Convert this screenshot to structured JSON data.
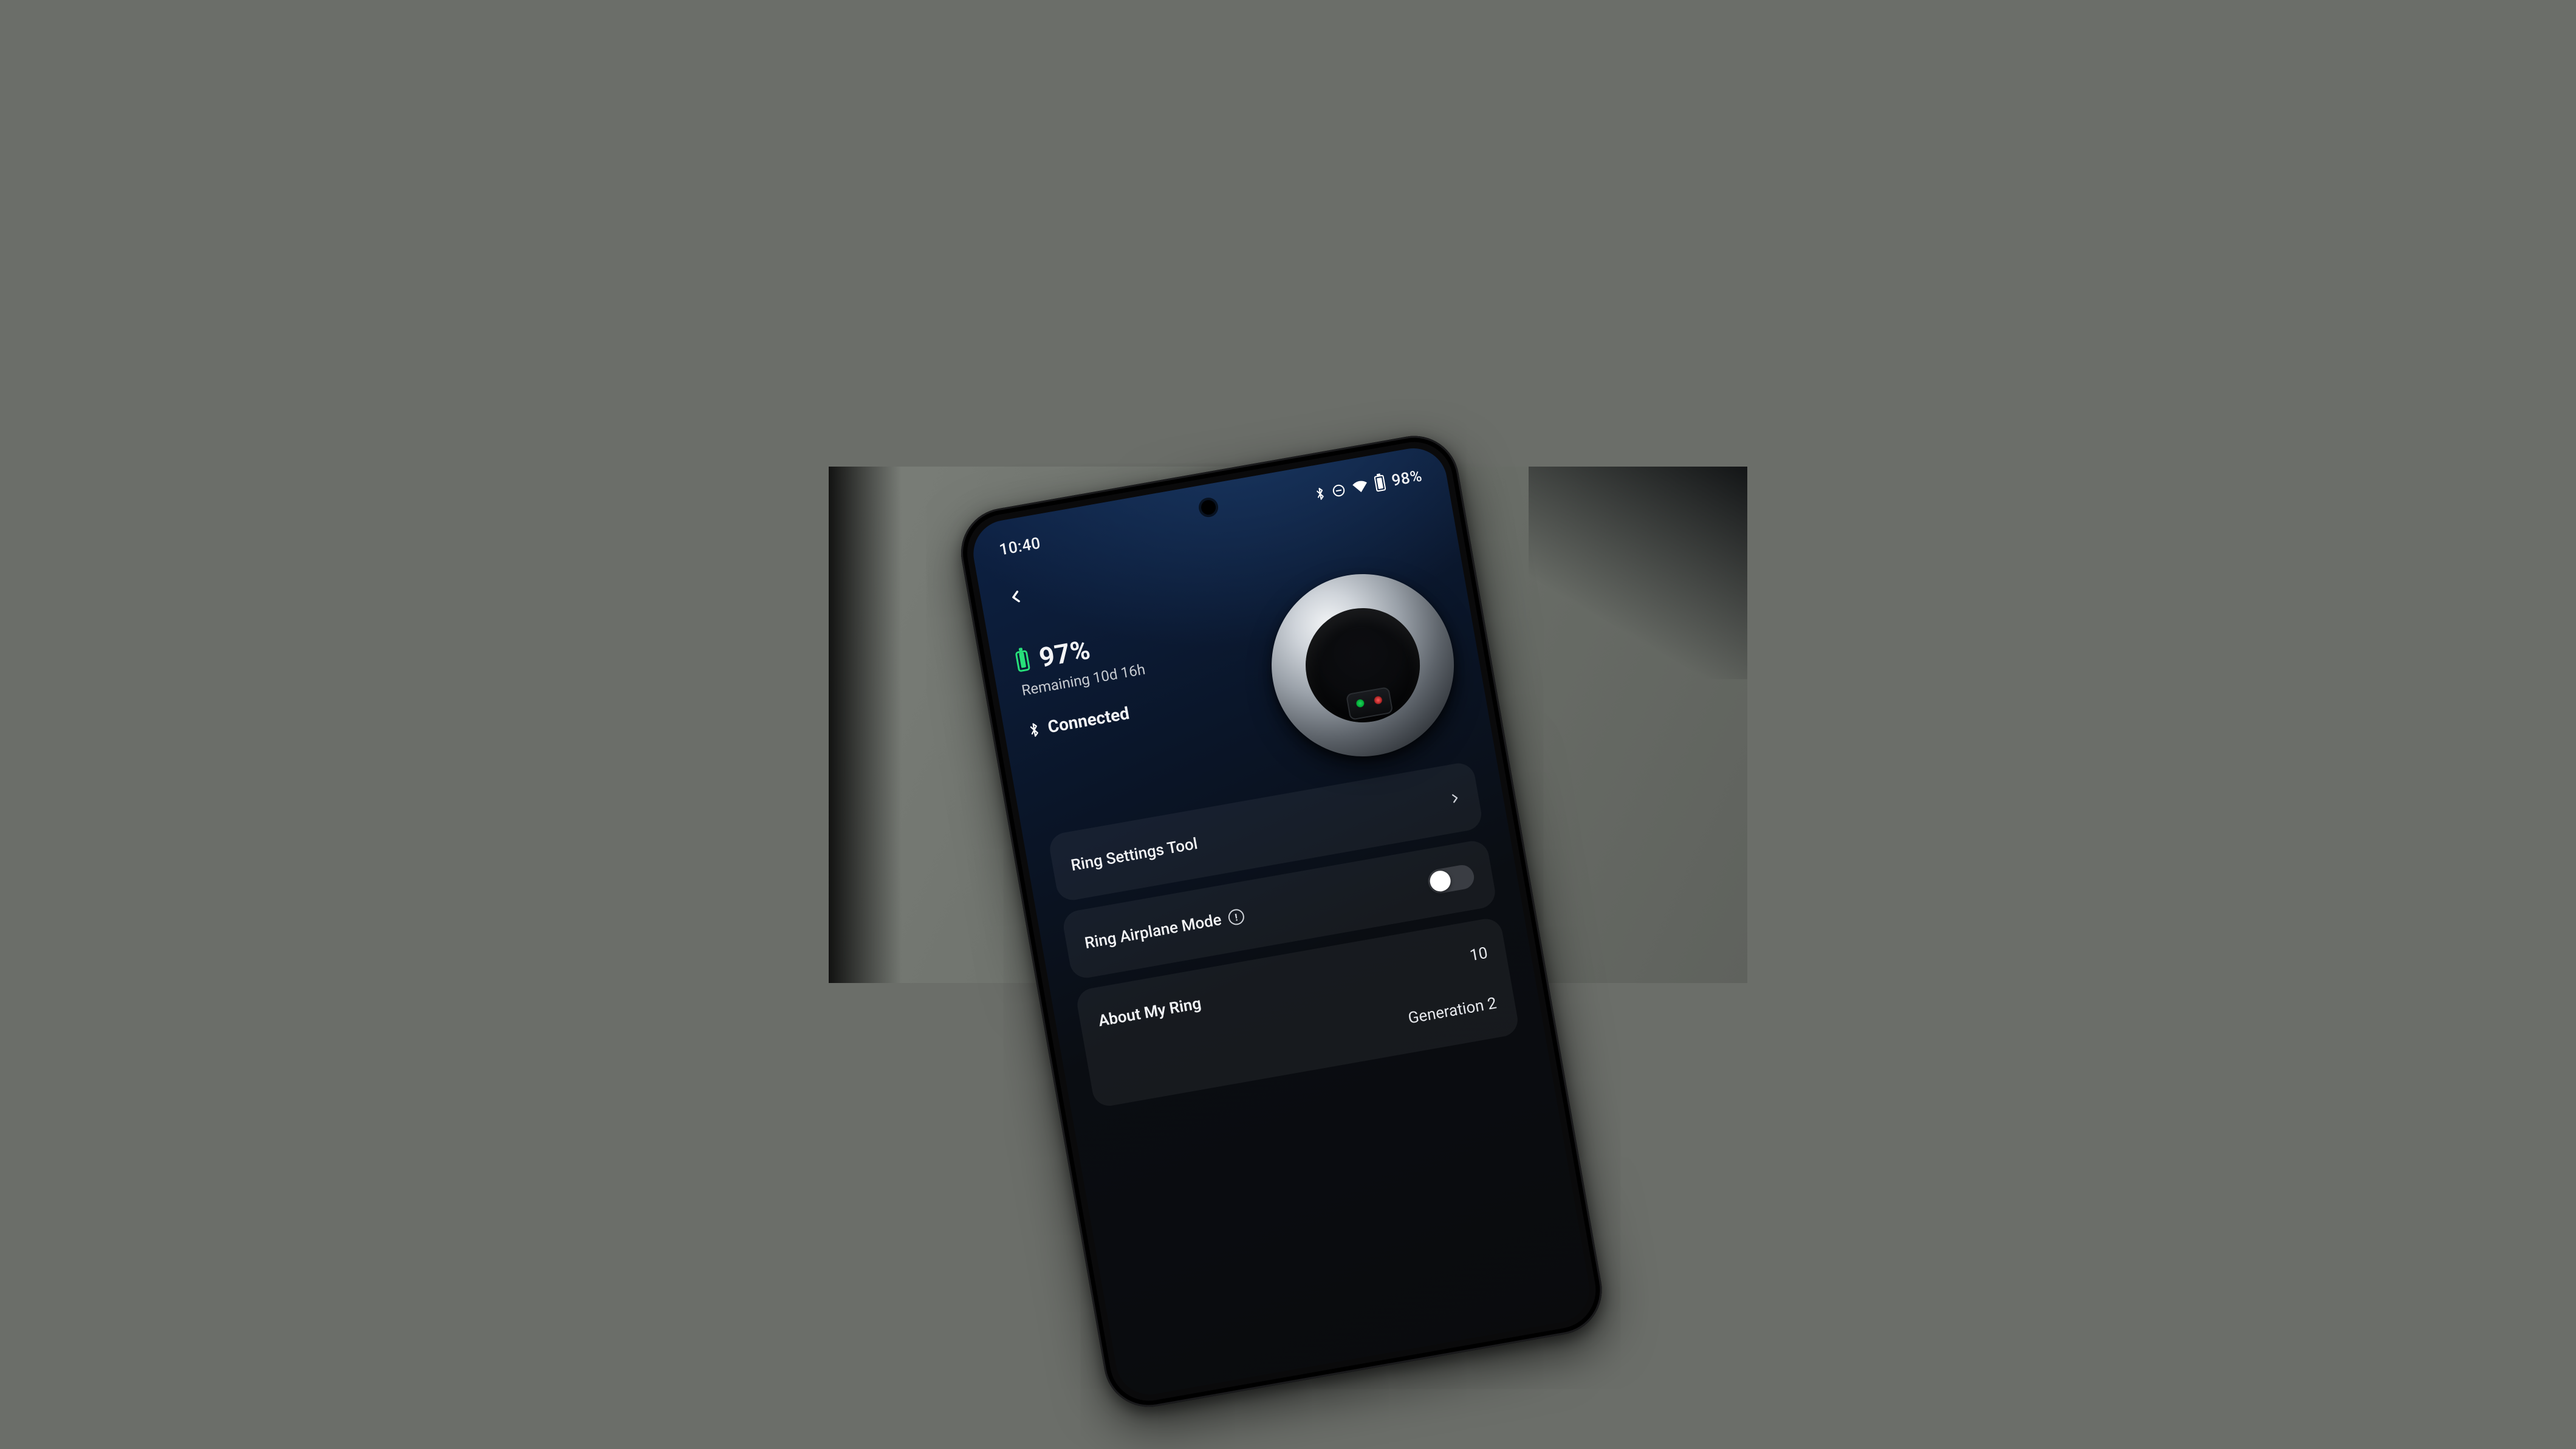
{
  "status_bar": {
    "time": "10:40",
    "battery_pct": "98%"
  },
  "device": {
    "battery_pct": "97%",
    "remaining": "Remaining 10d 16h",
    "connection": "Connected"
  },
  "settings": {
    "ring_settings_tool": "Ring Settings Tool",
    "airplane_mode": "Ring Airplane Mode"
  },
  "about": {
    "header": "About My Ring",
    "size_value": "10",
    "generation_value": "Generation 2"
  }
}
